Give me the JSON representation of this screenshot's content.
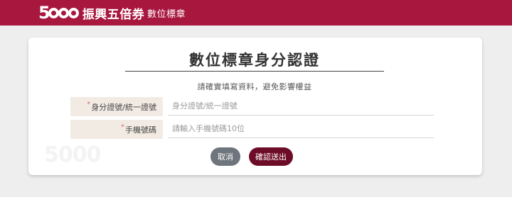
{
  "header": {
    "logo_mark": "5",
    "logo_text": "振興五倍券",
    "section_title": "數位標章"
  },
  "card": {
    "watermark": "5000",
    "title": "數位標章身分認證",
    "subtitle": "請確實填寫資料，避免影響權益"
  },
  "form": {
    "required_mark": "*",
    "id_field": {
      "label": "身分證號/統一證號",
      "placeholder": "身分證號/統一證號",
      "value": ""
    },
    "phone_field": {
      "label": "手機號碼",
      "placeholder": "請輸入手機號碼10位",
      "value": ""
    }
  },
  "actions": {
    "cancel_label": "取消",
    "submit_label": "確認送出"
  },
  "colors": {
    "header_bg": "#a8173e",
    "label_bg": "#f2ebe3",
    "required": "#e26b7d",
    "cancel_button": "#6e757c",
    "submit_button": "#6d0c27"
  }
}
